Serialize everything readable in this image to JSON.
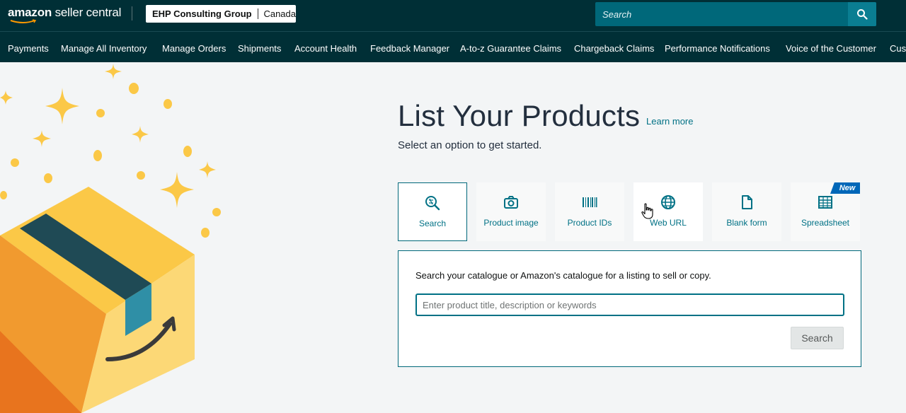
{
  "header": {
    "logo_brand": "amazon",
    "logo_suffix": "seller central",
    "account_name": "EHP Consulting Group",
    "marketplace": "Canada",
    "search_placeholder": "Search"
  },
  "nav": {
    "items": [
      "Payments",
      "Manage All Inventory",
      "Manage Orders",
      "Shipments",
      "Account Health",
      "Feedback Manager",
      "A-to-z Guarantee Claims",
      "Chargeback Claims",
      "Performance Notifications",
      "Voice of the Customer",
      "Cust"
    ]
  },
  "main": {
    "title": "List Your Products",
    "learn_more": "Learn more",
    "subtitle": "Select an option to get started.",
    "options": [
      {
        "label": "Search",
        "icon": "search-icon",
        "selected": true
      },
      {
        "label": "Product image",
        "icon": "camera-icon",
        "selected": false
      },
      {
        "label": "Product IDs",
        "icon": "barcode-icon",
        "selected": false
      },
      {
        "label": "Web URL",
        "icon": "globe-icon",
        "selected": false
      },
      {
        "label": "Blank form",
        "icon": "document-icon",
        "selected": false
      },
      {
        "label": "Spreadsheet",
        "icon": "spreadsheet-icon",
        "selected": false
      }
    ],
    "new_badge": "New",
    "panel": {
      "description": "Search your catalogue or Amazon's catalogue for a listing to sell or copy.",
      "input_placeholder": "Enter product title, description or keywords",
      "input_value": "",
      "button_label": "Search"
    }
  },
  "colors": {
    "header_bg": "#002f36",
    "accent_teal": "#007185",
    "badge_blue": "#0067b8",
    "box_yellow": "#fbc847",
    "box_orange": "#e8741e"
  }
}
